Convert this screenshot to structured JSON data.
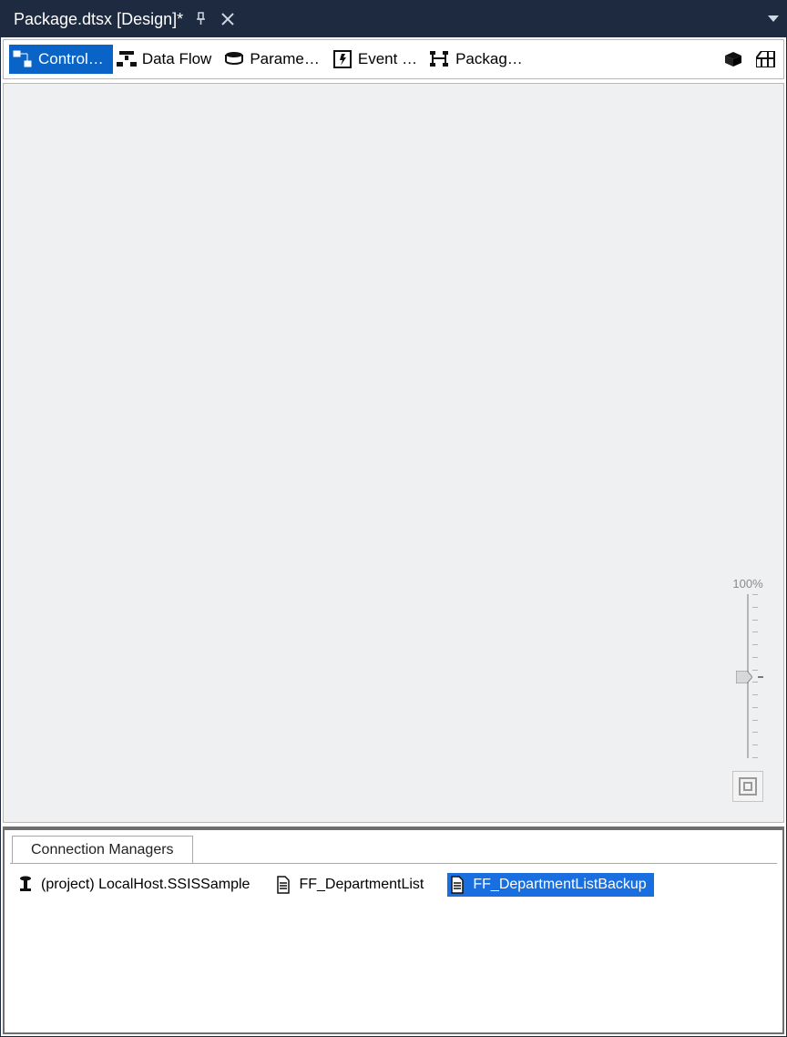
{
  "titlebar": {
    "title": "Package.dtsx [Design]*"
  },
  "tabs": [
    {
      "label": "Control…",
      "active": true
    },
    {
      "label": "Data Flow",
      "active": false
    },
    {
      "label": "Parame…",
      "active": false
    },
    {
      "label": "Event …",
      "active": false
    },
    {
      "label": "Packag…",
      "active": false
    }
  ],
  "zoom": {
    "label": "100%"
  },
  "connection_managers": {
    "tab": "Connection Managers",
    "items": [
      {
        "label": "(project) LocalHost.SSISSample",
        "selected": false
      },
      {
        "label": "FF_DepartmentList",
        "selected": false
      },
      {
        "label": "FF_DepartmentListBackup",
        "selected": true
      }
    ]
  }
}
